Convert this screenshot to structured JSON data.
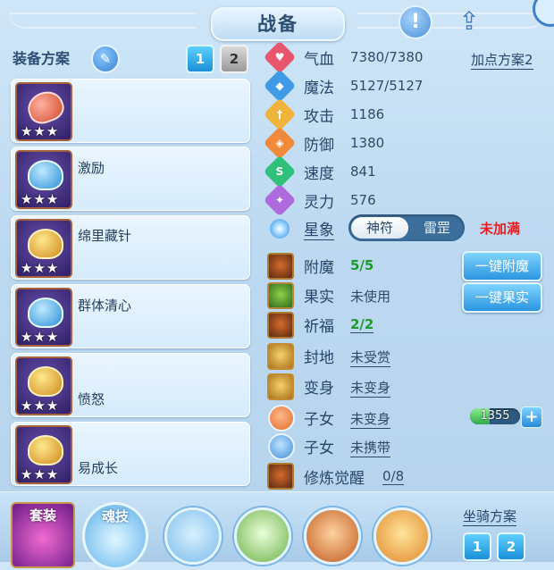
{
  "title": "战备",
  "left_panel": {
    "header": "装备方案",
    "plan_buttons": [
      "1",
      "2"
    ],
    "equipment": [
      {
        "name": "",
        "stars": "★★★"
      },
      {
        "name": "激励",
        "stars": "★★★"
      },
      {
        "name": "绵里藏针",
        "stars": "★★★"
      },
      {
        "name": "群体清心",
        "stars": "★★★"
      },
      {
        "name": "愤怒",
        "stars": "★★★"
      },
      {
        "name": "易成长",
        "stars": "★★★"
      }
    ]
  },
  "stats": [
    {
      "label": "气血",
      "value": "7380/7380",
      "icon": "heart-icon",
      "color": "#e8566b"
    },
    {
      "label": "魔法",
      "value": "5127/5127",
      "icon": "mana-icon",
      "color": "#3f9be6"
    },
    {
      "label": "攻击",
      "value": "1186",
      "icon": "attack-icon",
      "color": "#f0b43a"
    },
    {
      "label": "防御",
      "value": "1380",
      "icon": "defense-icon",
      "color": "#f08a3a"
    },
    {
      "label": "速度",
      "value": "841",
      "icon": "speed-icon",
      "color": "#2fc07a"
    },
    {
      "label": "灵力",
      "value": "576",
      "icon": "spirit-icon",
      "color": "#b06ae0"
    }
  ],
  "add_point_plan": "加点方案2",
  "star_sign": {
    "label": "星象",
    "options": [
      "神符",
      "雷罡"
    ],
    "selected": "神符",
    "status": "未加满"
  },
  "rows": {
    "enchant": {
      "label": "附魔",
      "value": "5/5"
    },
    "fruit": {
      "label": "果实",
      "value": "未使用"
    },
    "blessing": {
      "label": "祈福",
      "value": "2/2"
    },
    "fengdi": {
      "label": "封地",
      "value": "未受赏"
    },
    "transform": {
      "label": "变身",
      "value": "未变身"
    },
    "child1": {
      "label": "子女",
      "value": "未变身"
    },
    "child2": {
      "label": "子女",
      "value": "未携带"
    },
    "cultivation": {
      "label": "修炼觉醒",
      "value": "0/8"
    }
  },
  "buttons": {
    "one_key_enchant": "一键附魔",
    "one_key_fruit": "一键果实"
  },
  "mana_meter": {
    "value": "1355",
    "fill_fraction": 0.4
  },
  "bottom": {
    "suit_label": "套装",
    "soul_label": "魂技",
    "mount_label": "坐骑方案",
    "mount_buttons": [
      "1",
      "2"
    ]
  }
}
